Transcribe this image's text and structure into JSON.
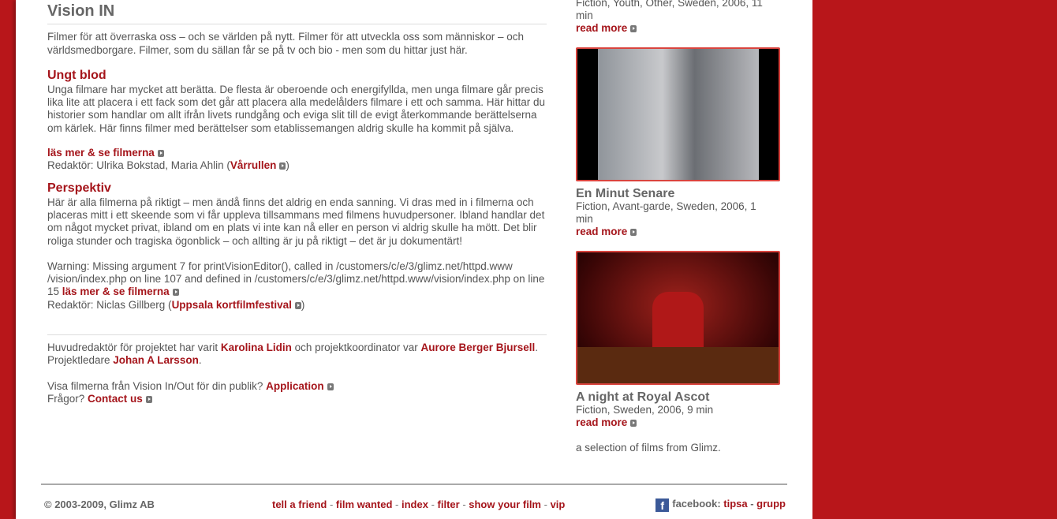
{
  "main": {
    "title": "Vision IN",
    "intro": "Filmer för att överraska oss – och se världen på nytt. Filmer för att utveckla oss som människor – och världsmedborgare. Filmer, som du sällan får se på tv och bio - men som du hittar just här.",
    "sections": [
      {
        "title": "Ungt blod",
        "text": "Unga filmare har mycket att berätta. De flesta är oberoende och energifyllda, men unga filmare går precis lika lite att placera i ett fack som det går att placera alla medelålders filmare i ett och samma. Här hittar du historier som handlar om allt ifrån livets rundgång och eviga slit till de evigt återkommande berättelserna om kärlek. Här finns filmer med berättelser som etablissemangen aldrig skulle ha kommit på själva.",
        "link": "läs mer & se filmerna",
        "editor_prefix": "Redaktör: Ulrika Bokstad, Maria Ahlin (",
        "editor_link": "Vårrullen",
        "editor_suffix": ")"
      },
      {
        "title": "Perspektiv",
        "text": "Här är alla filmerna på riktigt – men ändå finns det aldrig en enda sanning. Vi dras med in i filmerna och placeras mitt i ett skeende som vi får uppleva tillsammans med filmens huvudpersoner. Ibland handlar det om något mycket privat, ibland om en plats vi inte kan nå eller en person vi aldrig skulle ha mött. Det blir roliga stunder och tragiska ögonblick – och allting är ju på riktigt – det är ju dokumentärt!",
        "warning": "Warning: Missing argument 7 for printVisionEditor(), called in /customers/c/e/3/glimz.net/httpd.www /vision/index.php on line 107 and defined in /customers/c/e/3/glimz.net/httpd.www/vision/index.php on line 15",
        "link": "läs mer & se filmerna",
        "editor_prefix": "Redaktör: Niclas Gillberg (",
        "editor_link": "Uppsala kortfilmfestival",
        "editor_suffix": ")"
      }
    ],
    "credits": {
      "t1": "Huvudredaktör för projektet har varit ",
      "n1": "Karolina Lidin",
      "t2": " och projektkoordinator var ",
      "n2": "Aurore Berger Bjursell",
      "t3": ". Projektledare ",
      "n3": "Johan A Larsson",
      "t4": "."
    },
    "publik": {
      "text": "Visa filmerna från Vision In/Out för din publik? ",
      "link": "Application"
    },
    "questions": {
      "text": "Frågor? ",
      "link": "Contact us"
    }
  },
  "side": {
    "top_meta": "Fiction, Youth, Other, Sweden, 2006, 11 min",
    "read_more": "read more",
    "films": [
      {
        "title": "En Minut Senare",
        "meta": "Fiction, Avant-garde, Sweden, 2006, 1 min"
      },
      {
        "title": "A night at Royal Ascot",
        "meta": "Fiction, Sweden, 2006, 9 min"
      }
    ],
    "selection": "a selection of films from Glimz."
  },
  "footer": {
    "copyright": "© 2003-2009, Glimz AB",
    "links": [
      "tell a friend",
      "film wanted",
      "index",
      "filter",
      "show your film",
      "vip"
    ],
    "facebook": "facebook: ",
    "fb_links": [
      "tipsa",
      "grupp"
    ]
  }
}
